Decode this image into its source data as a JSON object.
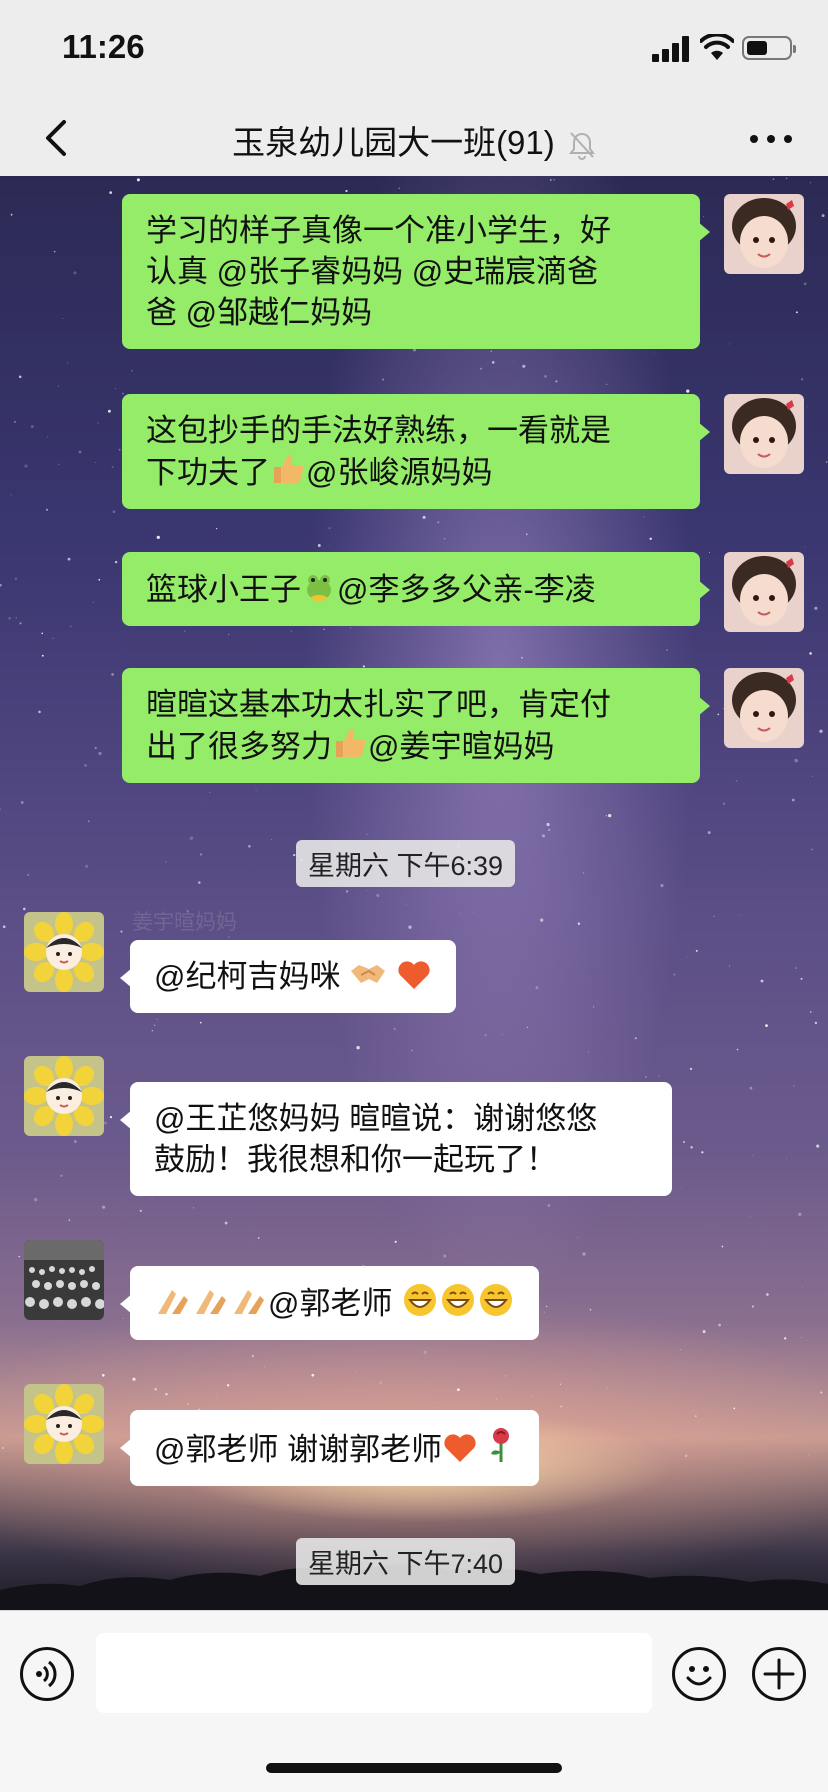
{
  "status_bar": {
    "time": "11:26"
  },
  "header": {
    "title": "玉泉幼儿园大一班(91)"
  },
  "messages_outgoing": [
    {
      "text_lines": [
        "学习的样子真像一个准小学生，好",
        "认真 @张子睿妈妈 @史瑞宸滴爸",
        "爸 @邹越仁妈妈"
      ]
    },
    {
      "text_before_emoji": "这包抄手的手法好熟练，一看就是",
      "line2_before": "下功夫了",
      "emoji": "thumbs-up",
      "line2_after": "@张峻源妈妈"
    },
    {
      "text_before": "篮球小王子",
      "emoji": "frog",
      "text_after": "@李多多父亲-李凌"
    },
    {
      "line1": "暄暄这基本功太扎实了吧，肯定付",
      "line2_before": "出了很多努力",
      "emoji": "thumbs-up",
      "line2_after": "@姜宇暄妈妈"
    }
  ],
  "timestamps": [
    "星期六 下午6:39",
    "星期六 下午7:40"
  ],
  "messages_incoming": [
    {
      "sender": "姜宇暄妈妈",
      "text": "@纪柯吉妈咪 ",
      "emojis": [
        "handshake",
        "heart"
      ]
    },
    {
      "sender": "",
      "line1": "@王芷悠妈妈 暄暄说：谢谢悠悠",
      "line2": "鼓励！我很想和你一起玩了！"
    },
    {
      "sender": "",
      "text": "@郭老师 ",
      "emojis_before": [
        "pray",
        "pray",
        "pray"
      ],
      "emojis_after": [
        "grin",
        "grin",
        "grin"
      ]
    },
    {
      "sender": "",
      "text": "@郭老师 谢谢郭老师",
      "emojis": [
        "heart",
        "rose"
      ]
    }
  ],
  "input": {
    "placeholder": ""
  },
  "icons": {
    "back": "chevron-left-icon",
    "mute": "bell-off-icon",
    "more": "more-dots-icon",
    "voice": "voice-icon",
    "emoji": "smiley-icon",
    "plus": "plus-icon"
  },
  "colors": {
    "outgoing_bubble": "#95ec69",
    "incoming_bubble": "#ffffff",
    "bar_background": "#ededed"
  }
}
